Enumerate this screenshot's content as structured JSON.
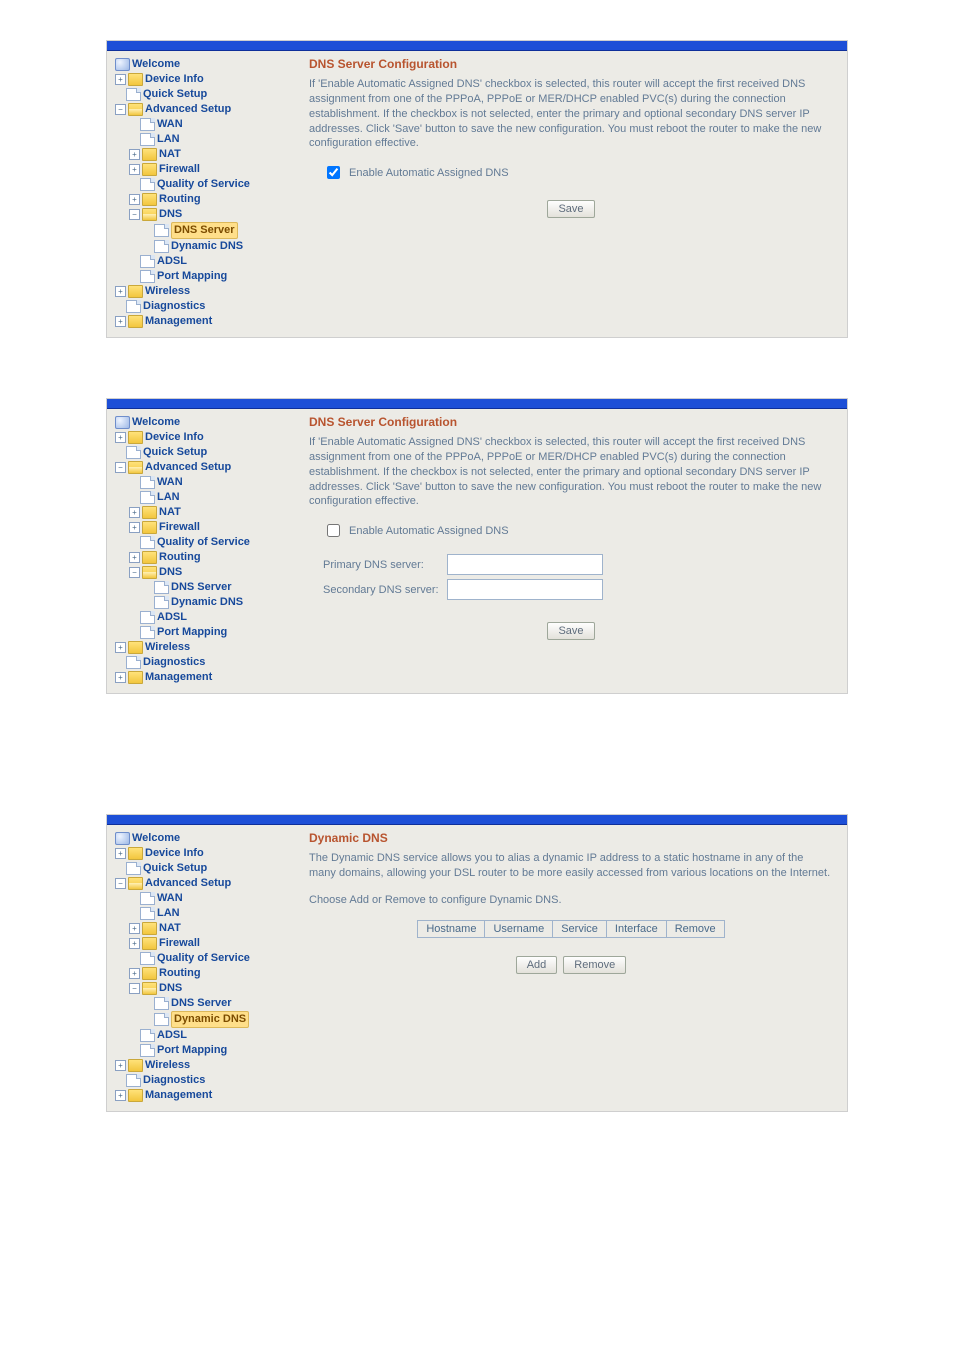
{
  "nav": {
    "welcome": "Welcome",
    "device_info": "Device Info",
    "quick_setup": "Quick Setup",
    "advanced_setup": "Advanced Setup",
    "wan": "WAN",
    "lan": "LAN",
    "nat": "NAT",
    "firewall": "Firewall",
    "qos": "Quality of Service",
    "routing": "Routing",
    "dns": "DNS",
    "dns_server": "DNS Server",
    "dynamic_dns": "Dynamic DNS",
    "adsl": "ADSL",
    "port_mapping": "Port Mapping",
    "wireless": "Wireless",
    "diagnostics": "Diagnostics",
    "management": "Management"
  },
  "panel1": {
    "title": "DNS Server Configuration",
    "desc": "If 'Enable Automatic Assigned DNS' checkbox is selected, this router will accept the first received DNS assignment from one of the PPPoA, PPPoE or MER/DHCP enabled PVC(s) during the connection establishment. If the checkbox is not selected, enter the primary and optional secondary DNS server IP addresses. Click 'Save' button to save the new configuration. You must reboot the router to make the new configuration effective.",
    "checkbox_label": "Enable Automatic Assigned DNS",
    "checked": true,
    "save": "Save"
  },
  "panel2": {
    "title": "DNS Server Configuration",
    "desc": "If 'Enable Automatic Assigned DNS' checkbox is selected, this router will accept the first received DNS assignment from one of the PPPoA, PPPoE or MER/DHCP enabled PVC(s) during the connection establishment. If the checkbox is not selected, enter the primary and optional secondary DNS server IP addresses. Click 'Save' button to save the new configuration. You must reboot the router to make the new configuration effective.",
    "checkbox_label": "Enable Automatic Assigned DNS",
    "checked": false,
    "primary_label": "Primary DNS server:",
    "secondary_label": "Secondary DNS server:",
    "primary_value": "",
    "secondary_value": "",
    "save": "Save"
  },
  "panel3": {
    "title": "Dynamic DNS",
    "desc": "The Dynamic DNS service allows you to alias a dynamic IP address to a static hostname in any of the many domains, allowing your DSL router to be more easily accessed from various locations on the Internet.",
    "instruction": "Choose Add or Remove to configure Dynamic DNS.",
    "headers": [
      "Hostname",
      "Username",
      "Service",
      "Interface",
      "Remove"
    ],
    "add": "Add",
    "remove": "Remove"
  }
}
